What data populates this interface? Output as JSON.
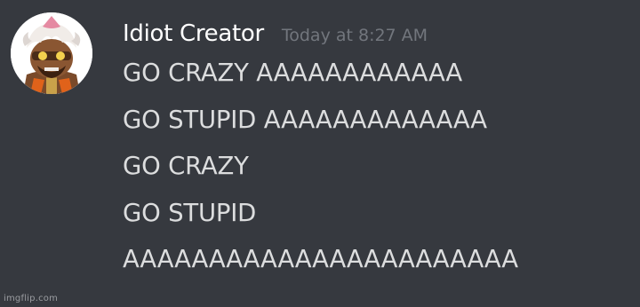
{
  "message": {
    "author": "Idiot Creator",
    "timestamp": "Today at 8:27 AM",
    "lines": [
      "GO CRAZY AAAAAAAAAAAA",
      "GO STUPID AAAAAAAAAAAAA",
      "GO CRAZY",
      "GO STUPID",
      "AAAAAAAAAAAAAAAAAAAAAAA"
    ]
  },
  "watermark": "imgflip.com",
  "colors": {
    "background": "#36393f",
    "username": "#ffffff",
    "timestamp": "#72767d",
    "message_text": "#dcddde"
  },
  "avatar_icon": "cartoon-character-avatar"
}
